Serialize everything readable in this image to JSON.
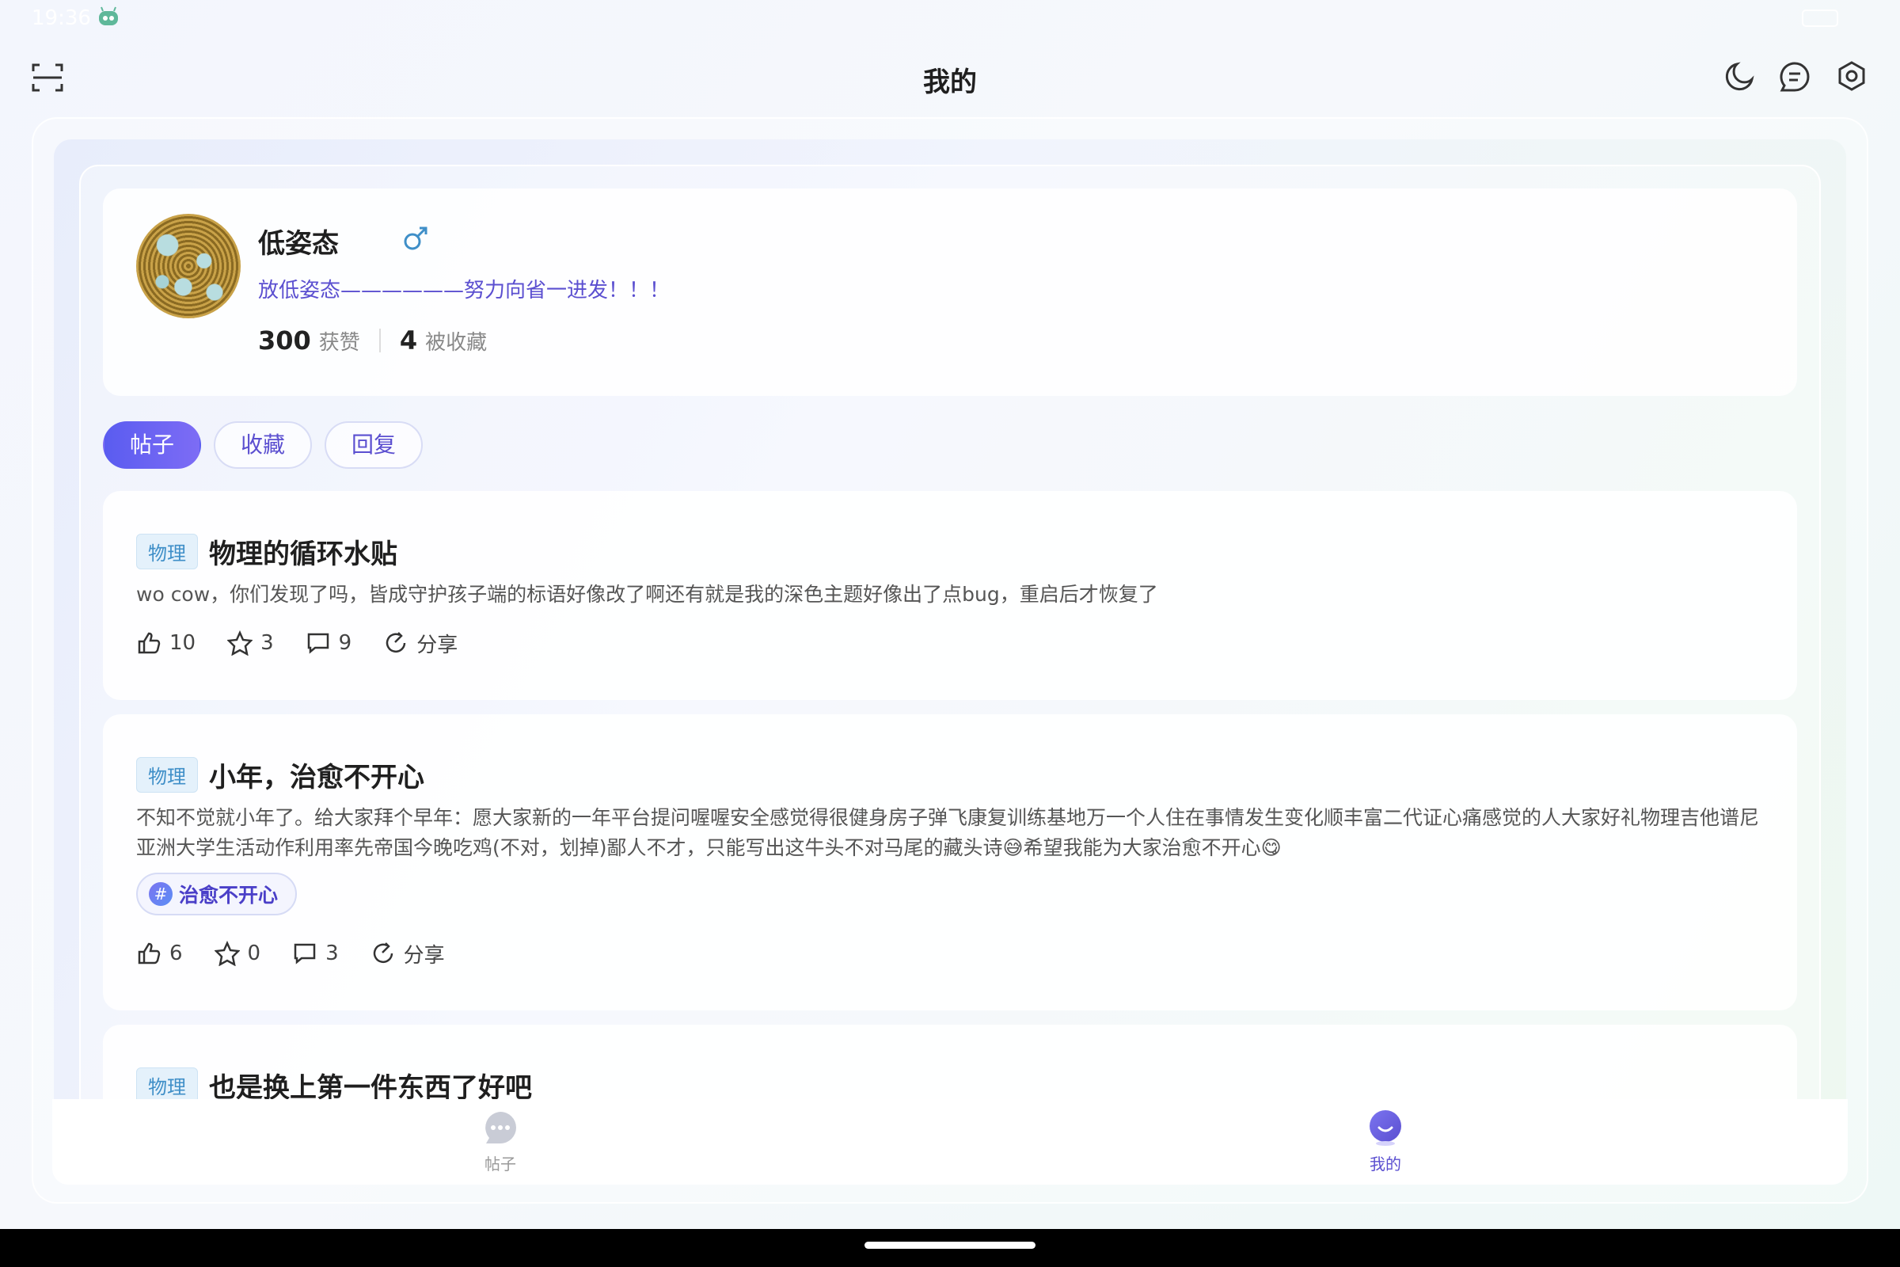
{
  "status": {
    "time": "19:36"
  },
  "header": {
    "title": "我的"
  },
  "profile": {
    "name": "低姿态",
    "signature": "放低姿态——————努力向省一进发！！！",
    "likes_count": "300",
    "likes_label": "获赞",
    "favorited_count": "4",
    "favorited_label": "被收藏"
  },
  "tabs": [
    {
      "label": "帖子",
      "active": true
    },
    {
      "label": "收藏",
      "active": false
    },
    {
      "label": "回复",
      "active": false
    }
  ],
  "posts": [
    {
      "tag": "物理",
      "title": "物理的循环水贴",
      "body": "wo cow，你们发现了吗，皆成守护孩子端的标语好像改了啊还有就是我的深色主题好像出了点bug，重启后才恢复了",
      "likes": "10",
      "stars": "3",
      "comments": "9",
      "share_label": "分享"
    },
    {
      "tag": "物理",
      "title": "小年，治愈不开心",
      "body": "不知不觉就小年了。给大家拜个早年：愿大家新的一年平台提问喔喔安全感觉得很健身房子弹飞康复训练基地万一个人住在事情发生变化顺丰富二代证心痛感觉的人大家好礼物理吉他谱尼亚洲大学生活动作利用率先帝国今晚吃鸡(不对，划掉)鄙人不才，只能写出这牛头不对马尾的藏头诗😅希望我能为大家治愈不开心😋",
      "topic": "治愈不开心",
      "likes": "6",
      "stars": "0",
      "comments": "3",
      "share_label": "分享"
    },
    {
      "tag": "物理",
      "title": "也是换上第一件东西了好吧"
    }
  ],
  "bottom_nav": [
    {
      "label": "帖子",
      "icon": "chat-bubble-icon",
      "active": false
    },
    {
      "label": "我的",
      "icon": "profile-face-icon",
      "active": true
    }
  ],
  "colors": {
    "accent": "#5b4fd0",
    "tag_blue": "#3f8fc8"
  }
}
